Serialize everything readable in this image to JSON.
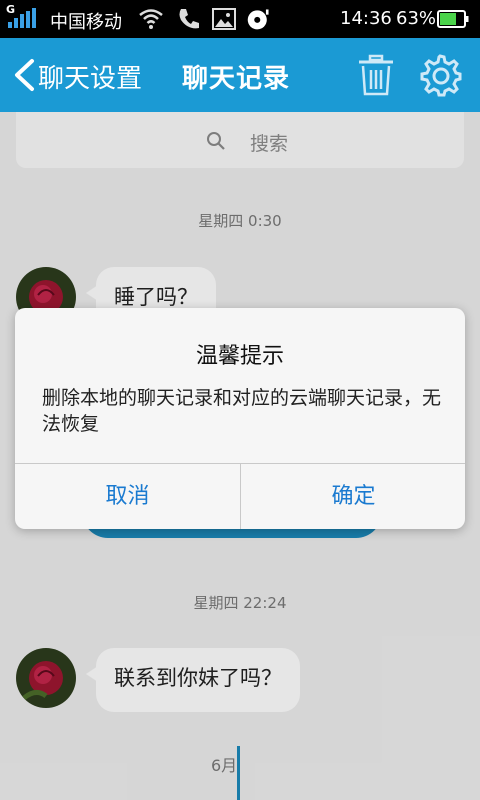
{
  "status_bar": {
    "network_badge": "G",
    "carrier": "中国移动",
    "time": "14:36",
    "battery_percent": "63%",
    "icons": [
      "signal-icon",
      "wifi-icon",
      "phone-icon",
      "image-icon",
      "media-icon",
      "battery-icon"
    ]
  },
  "title_bar": {
    "back_label": "聊天设置",
    "title": "聊天记录",
    "icons": [
      "back-chevron-icon",
      "trash-icon",
      "gear-icon"
    ],
    "accent_color": "#1b9ad4"
  },
  "search": {
    "placeholder": "搜索"
  },
  "chat": {
    "timestamps": [
      "星期四 0:30",
      "星期四 22:24"
    ],
    "messages": [
      {
        "text": "睡了吗？",
        "from": "other"
      },
      {
        "text": "联系到你妹了吗？",
        "from": "other"
      }
    ],
    "month_label": "6月"
  },
  "dialog": {
    "title": "温馨提示",
    "message": "删除本地的聊天记录和对应的云端聊天记录，无法恢复",
    "cancel_label": "取消",
    "confirm_label": "确定",
    "button_color": "#1a7ad0"
  }
}
